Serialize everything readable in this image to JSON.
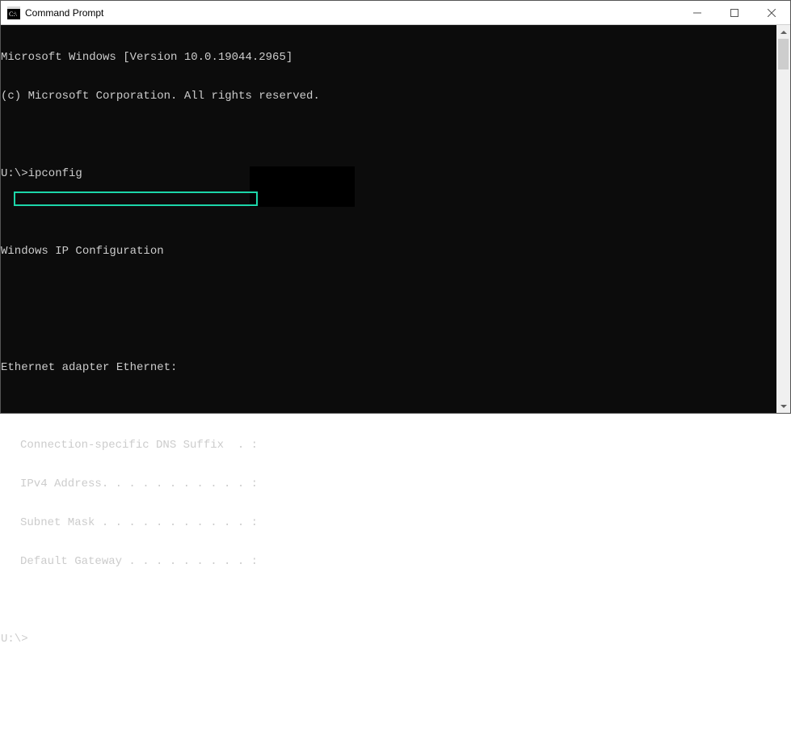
{
  "window": {
    "title": "Command Prompt"
  },
  "terminal": {
    "lines": {
      "l0": "Microsoft Windows [Version 10.0.19044.2965]",
      "l1": "(c) Microsoft Corporation. All rights reserved.",
      "l2": "",
      "l3": "U:\\>ipconfig",
      "l4": "",
      "l5": "Windows IP Configuration",
      "l6": "",
      "l7": "",
      "l8": "Ethernet adapter Ethernet:",
      "l9": "",
      "l10": "Connection-specific DNS Suffix  . :",
      "l11": "IPv4 Address. . . . . . . . . . . :",
      "l12": "Subnet Mask . . . . . . . . . . . :",
      "l13": "Default Gateway . . . . . . . . . :",
      "l14": "",
      "l15": "U:\\>"
    }
  },
  "highlight": {
    "target_line": "Default Gateway"
  }
}
